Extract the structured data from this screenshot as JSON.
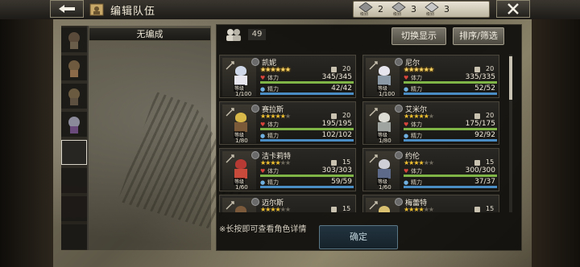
{
  "header": {
    "title": "编辑队伍",
    "currency": [
      {
        "sub": "级别",
        "value": "2"
      },
      {
        "sub": "级别",
        "value": "3"
      },
      {
        "sub": "级别",
        "value": "3"
      }
    ]
  },
  "party": {
    "name": "无编成",
    "slots": [
      {
        "filled": true,
        "hair": "#5a4a3a",
        "outfit": "#6a5d4a"
      },
      {
        "filled": true,
        "hair": "#6e5a3e",
        "outfit": "#8a6a48"
      },
      {
        "filled": true,
        "hair": "#6a5a40",
        "outfit": "#5e5040"
      },
      {
        "filled": true,
        "hair": "#8a8a9a",
        "outfit": "#6a4a7a"
      },
      {
        "filled": false
      },
      {
        "filled": false
      },
      {
        "filled": false
      },
      {
        "filled": false
      }
    ]
  },
  "toolbar": {
    "count": "49",
    "switch_label": "切换显示",
    "sort_label": "排序/筛选"
  },
  "stat_labels": {
    "hp": "体力",
    "mp": "精力",
    "level": "等级"
  },
  "units": [
    {
      "name": "凯妮",
      "stars": 6,
      "rainbow": true,
      "evo": "20",
      "level": "1/100",
      "hp": "345/345",
      "mp": "42/42",
      "hair": "#cfd8e8",
      "outfit": "#e8e6ef",
      "weapon": "#c9c2b0"
    },
    {
      "name": "尼尔",
      "stars": 6,
      "rainbow": true,
      "evo": "20",
      "level": "1/100",
      "hp": "335/335",
      "mp": "52/52",
      "hair": "#e6e4ec",
      "outfit": "#8c9aa8",
      "weapon": "#c9c2b0"
    },
    {
      "name": "赛拉斯",
      "stars": 5,
      "rainbow": false,
      "evo": "20",
      "level": "1/80",
      "hp": "195/195",
      "mp": "102/102",
      "hair": "#d8b848",
      "outfit": "#7a5a38",
      "weapon": "#c9c2b0"
    },
    {
      "name": "艾米尔",
      "stars": 5,
      "rainbow": false,
      "evo": "20",
      "level": "1/80",
      "hp": "175/175",
      "mp": "92/92",
      "hair": "#dcdcd4",
      "outfit": "#a0a4a0",
      "weapon": "#c9c2b0"
    },
    {
      "name": "洁卡莉特",
      "stars": 4,
      "rainbow": false,
      "evo": "15",
      "level": "1/60",
      "hp": "303/303",
      "mp": "59/59",
      "hair": "#b83a34",
      "outfit": "#c84a3a",
      "weapon": "#c9c2b0"
    },
    {
      "name": "约伦",
      "stars": 4,
      "rainbow": false,
      "evo": "15",
      "level": "1/60",
      "hp": "300/300",
      "mp": "37/37",
      "hair": "#cfcfd8",
      "outfit": "#5e6a8a",
      "weapon": "#c9c2b0"
    },
    {
      "name": "迈尔斯",
      "stars": 4,
      "rainbow": false,
      "evo": "15",
      "level": "1/60",
      "hp": "",
      "mp": "",
      "hair": "#7a5a3a",
      "outfit": "#6a5a48",
      "weapon": "#c9c2b0"
    },
    {
      "name": "梅蕾特",
      "stars": 4,
      "rainbow": false,
      "evo": "15",
      "level": "1/60",
      "hp": "",
      "mp": "",
      "hair": "#d8c070",
      "outfit": "#a08060",
      "weapon": "#c9c2b0"
    }
  ],
  "footer": {
    "hint": "※长按即可查看角色详情",
    "confirm_label": "确定"
  },
  "colors": {
    "hp_bar": "#7fb447",
    "mp_bar": "#4a8cc4",
    "hp_icon": "#d8453c",
    "mp_icon": "#6fb0e0"
  }
}
